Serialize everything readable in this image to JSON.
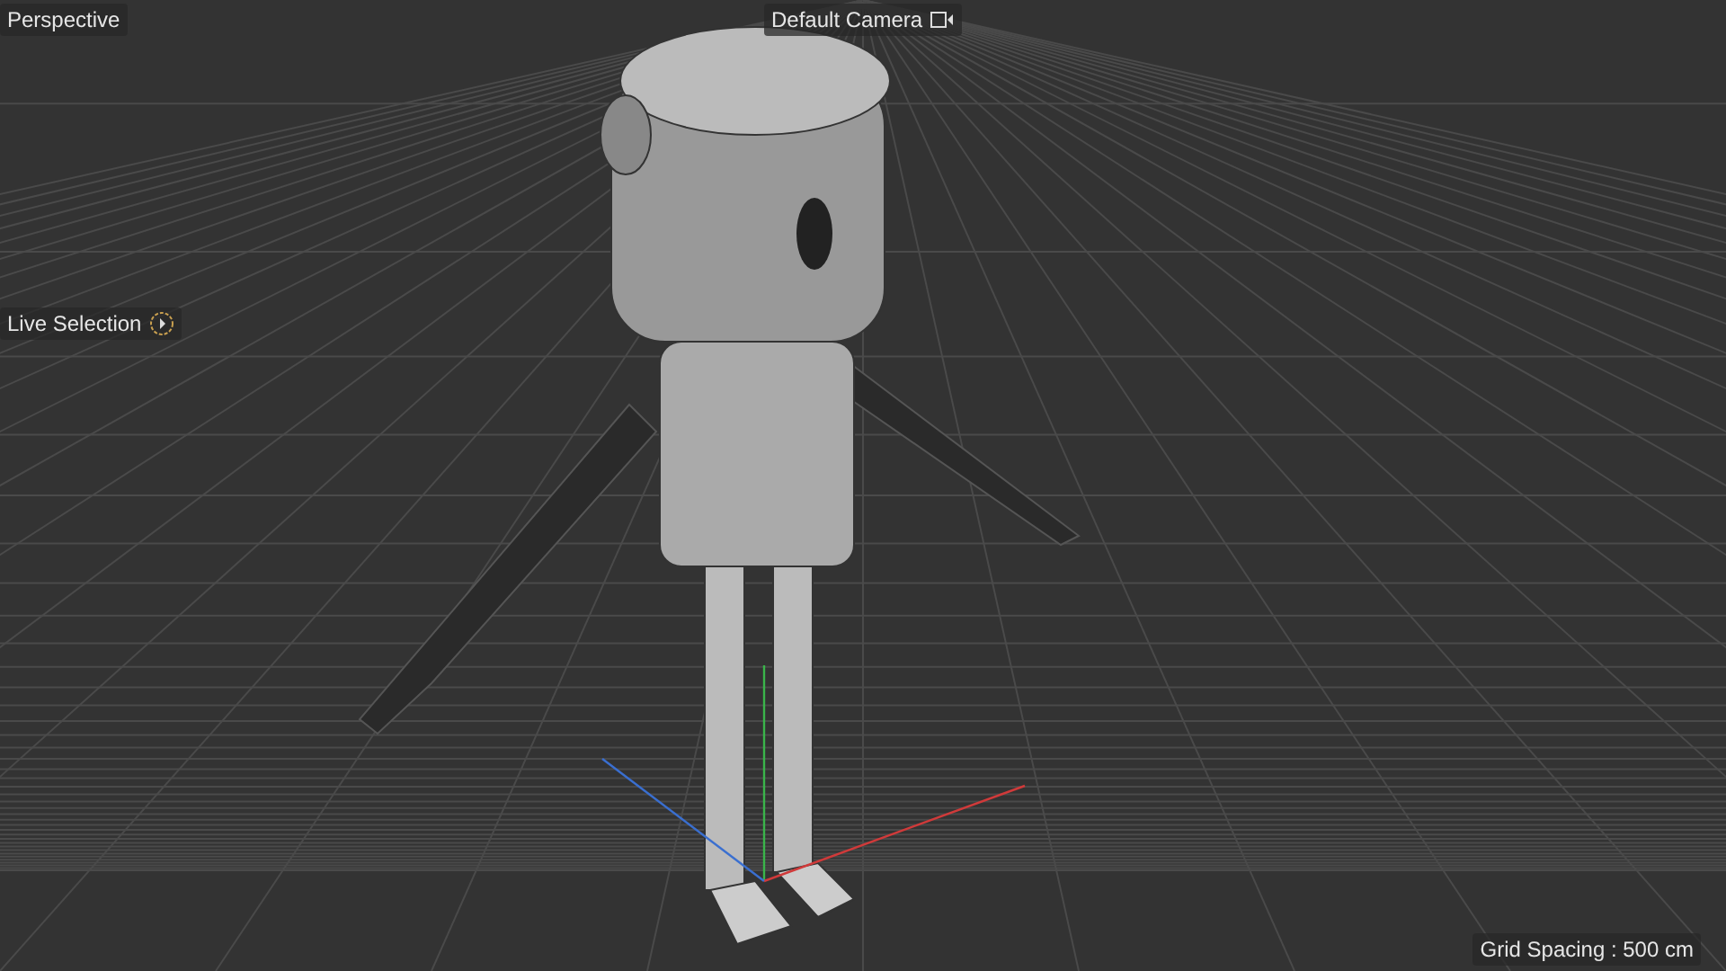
{
  "viewport": {
    "projection": "Perspective",
    "camera": "Default Camera",
    "tool": "Live Selection",
    "grid_spacing": "Grid Spacing : 500 cm"
  }
}
